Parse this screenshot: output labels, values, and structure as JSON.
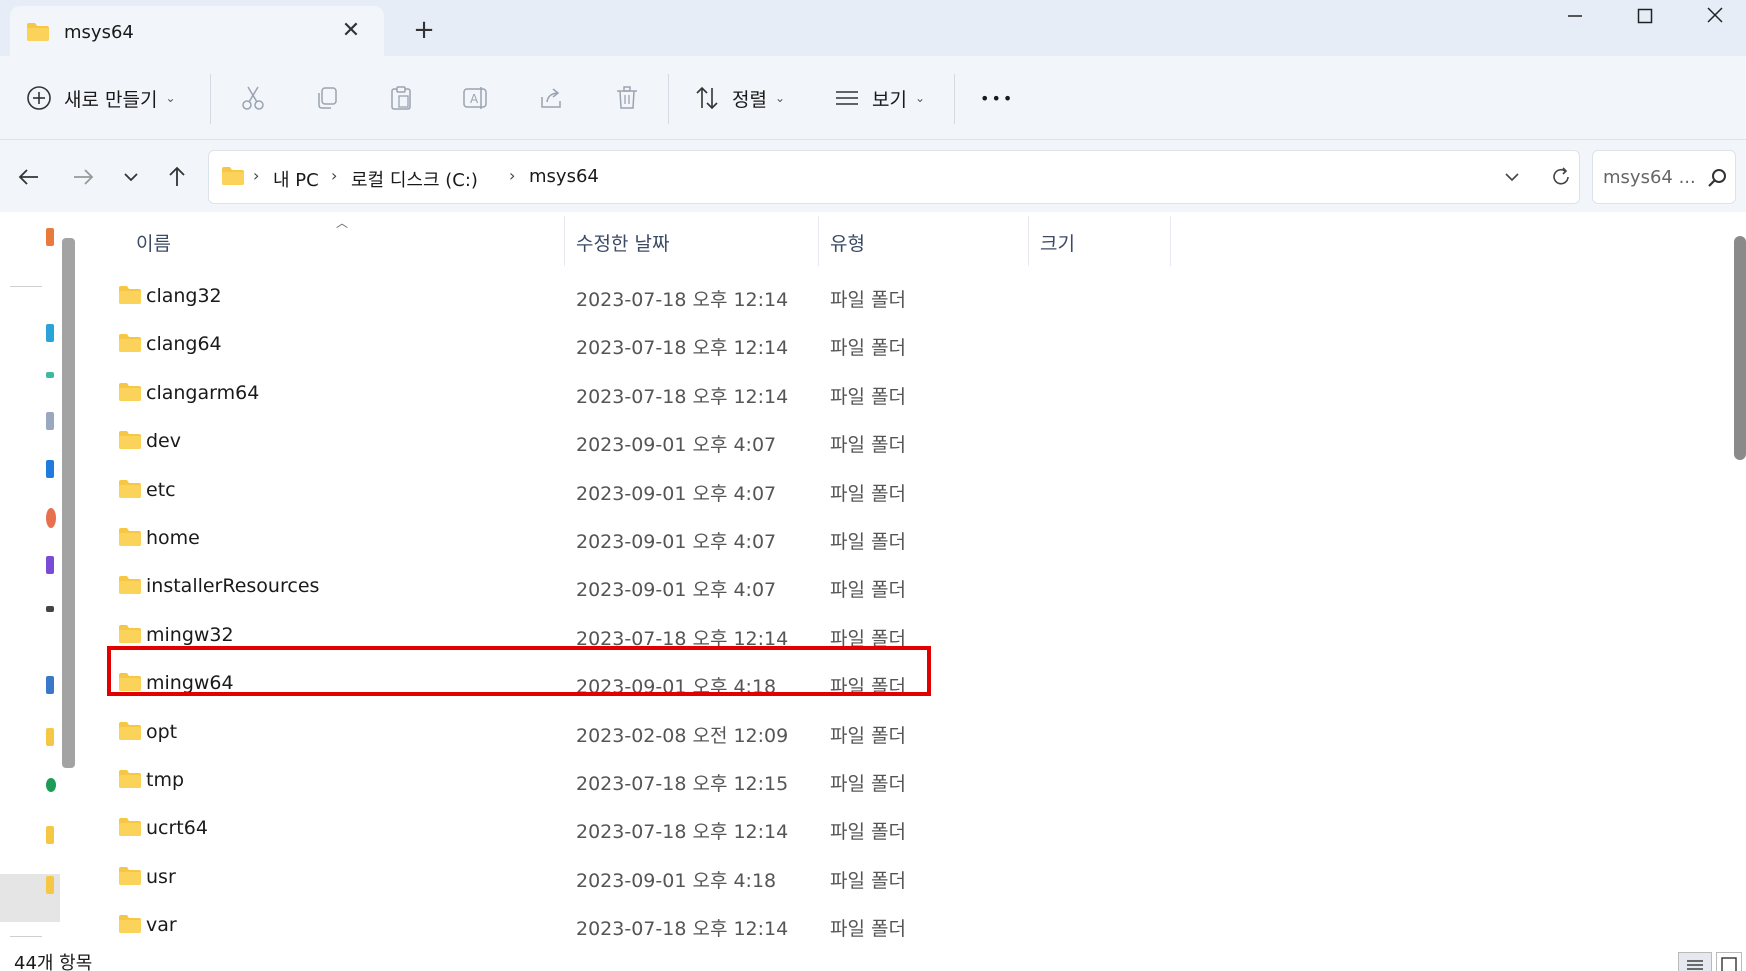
{
  "window": {
    "tab_title": "msys64",
    "close_tab_glyph": "✕",
    "new_tab_glyph": "+",
    "minimize_glyph": "—",
    "maximize_glyph": "☐",
    "close_glyph": "✕"
  },
  "toolbar": {
    "new_label": "새로 만들기",
    "sort_label": "정렬",
    "view_label": "보기",
    "more_label": "•••"
  },
  "address": {
    "crumbs": [
      "내 PC",
      "로컬 디스크 (C:)",
      "msys64"
    ],
    "search_placeholder": "msys64 ..."
  },
  "columns": {
    "name": "이름",
    "modified": "수정한 날짜",
    "type": "유형",
    "size": "크기"
  },
  "files": [
    {
      "name": "clang32",
      "modified": "2023-07-18 오후 12:14",
      "type": "파일 폴더"
    },
    {
      "name": "clang64",
      "modified": "2023-07-18 오후 12:14",
      "type": "파일 폴더"
    },
    {
      "name": "clangarm64",
      "modified": "2023-07-18 오후 12:14",
      "type": "파일 폴더"
    },
    {
      "name": "dev",
      "modified": "2023-09-01 오후 4:07",
      "type": "파일 폴더"
    },
    {
      "name": "etc",
      "modified": "2023-09-01 오후 4:07",
      "type": "파일 폴더"
    },
    {
      "name": "home",
      "modified": "2023-09-01 오후 4:07",
      "type": "파일 폴더"
    },
    {
      "name": "installerResources",
      "modified": "2023-09-01 오후 4:07",
      "type": "파일 폴더"
    },
    {
      "name": "mingw32",
      "modified": "2023-07-18 오후 12:14",
      "type": "파일 폴더"
    },
    {
      "name": "mingw64",
      "modified": "2023-09-01 오후 4:18",
      "type": "파일 폴더"
    },
    {
      "name": "opt",
      "modified": "2023-02-08 오전 12:09",
      "type": "파일 폴더"
    },
    {
      "name": "tmp",
      "modified": "2023-07-18 오후 12:15",
      "type": "파일 폴더"
    },
    {
      "name": "ucrt64",
      "modified": "2023-07-18 오후 12:14",
      "type": "파일 폴더"
    },
    {
      "name": "usr",
      "modified": "2023-09-01 오후 4:18",
      "type": "파일 폴더"
    },
    {
      "name": "var",
      "modified": "2023-07-18 오후 12:14",
      "type": "파일 폴더"
    }
  ],
  "status": {
    "item_count": "44개 항목"
  },
  "colors": {
    "folder_yellow": "#f6c744",
    "highlight_red": "#e00000",
    "chrome_bg": "#f2f6fb",
    "titlebar_bg": "#e7edf7"
  }
}
